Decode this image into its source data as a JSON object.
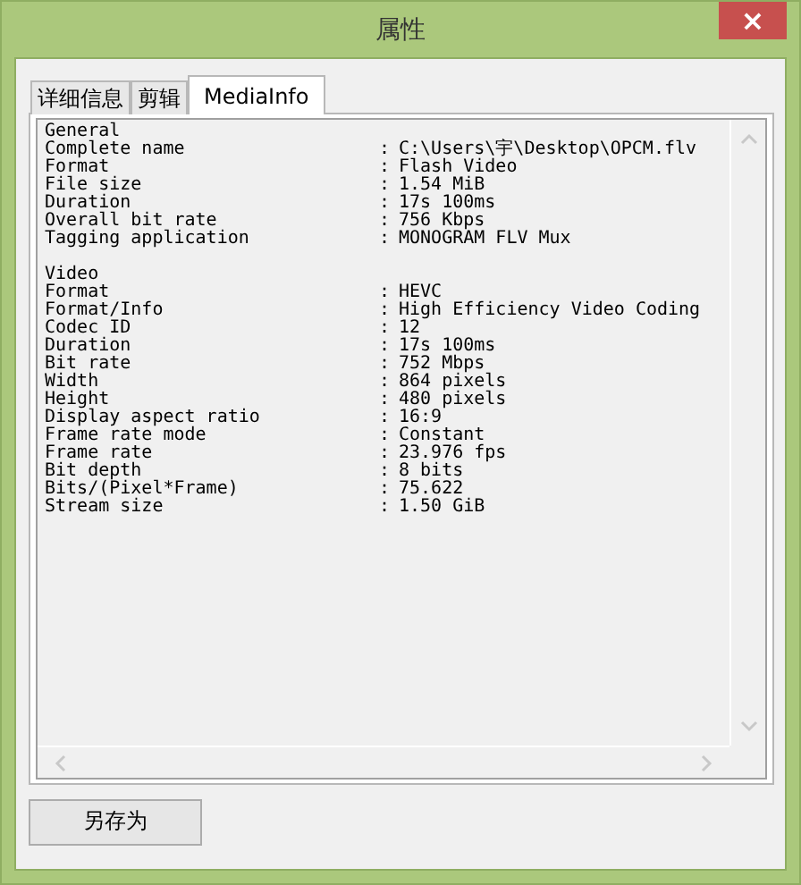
{
  "window": {
    "title": "属性",
    "close": "×"
  },
  "tabs": [
    {
      "label": "详细信息",
      "selected": false
    },
    {
      "label": "剪辑",
      "selected": false
    },
    {
      "label": "MediaInfo",
      "selected": true
    }
  ],
  "sections": [
    {
      "title": "General",
      "rows": [
        {
          "label": "Complete name",
          "value": "C:\\Users\\宇\\Desktop\\OPCM.flv"
        },
        {
          "label": "Format",
          "value": "Flash Video"
        },
        {
          "label": "File size",
          "value": "1.54 MiB"
        },
        {
          "label": "Duration",
          "value": "17s 100ms"
        },
        {
          "label": "Overall bit rate",
          "value": "756 Kbps"
        },
        {
          "label": "Tagging application",
          "value": "MONOGRAM FLV Mux"
        }
      ]
    },
    {
      "title": "Video",
      "rows": [
        {
          "label": "Format",
          "value": "HEVC"
        },
        {
          "label": "Format/Info",
          "value": "High Efficiency Video Coding"
        },
        {
          "label": "Codec ID",
          "value": "12"
        },
        {
          "label": "Duration",
          "value": "17s 100ms"
        },
        {
          "label": "Bit rate",
          "value": "752 Mbps"
        },
        {
          "label": "Width",
          "value": "864 pixels"
        },
        {
          "label": "Height",
          "value": "480 pixels"
        },
        {
          "label": "Display aspect ratio",
          "value": "16:9"
        },
        {
          "label": "Frame rate mode",
          "value": "Constant"
        },
        {
          "label": "Frame rate",
          "value": "23.976 fps"
        },
        {
          "label": "Bit depth",
          "value": "8 bits"
        },
        {
          "label": "Bits/(Pixel*Frame)",
          "value": "75.622"
        },
        {
          "label": "Stream size",
          "value": "1.50 GiB"
        }
      ]
    }
  ],
  "separator": ":",
  "buttons": [
    "另存为"
  ]
}
